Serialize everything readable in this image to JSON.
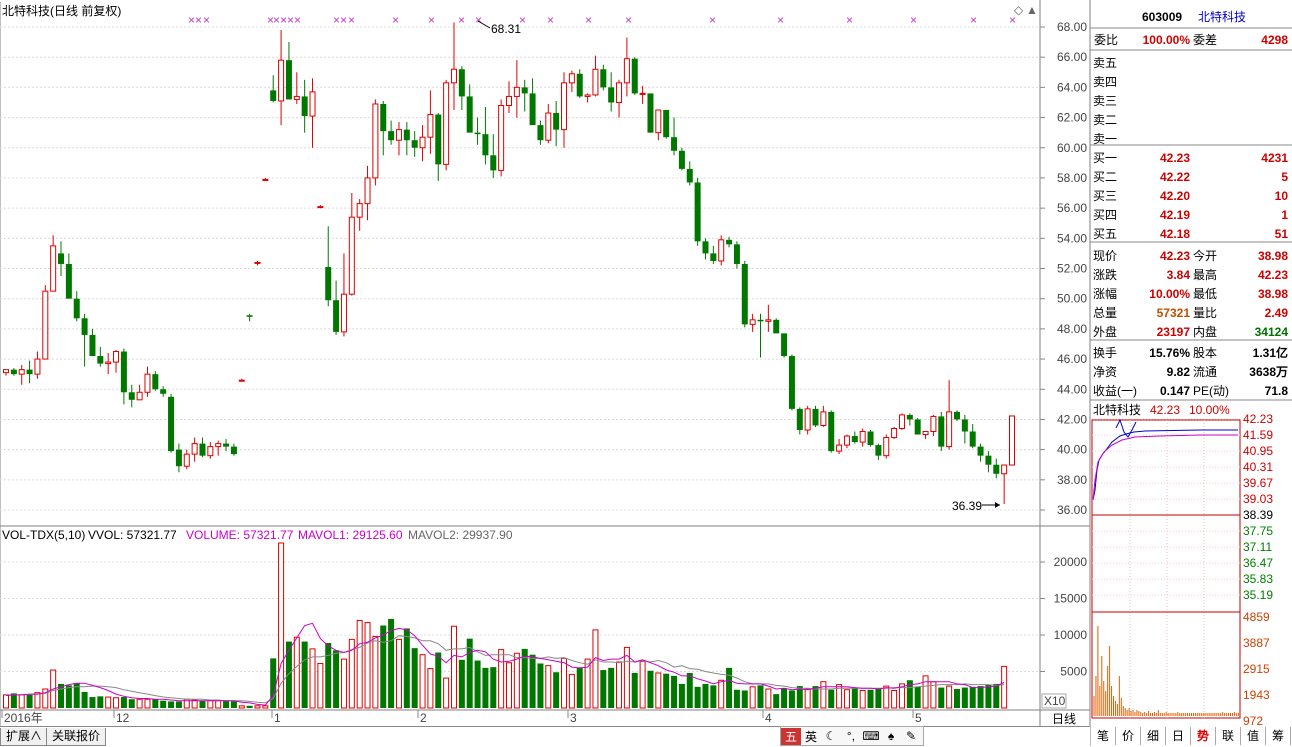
{
  "header": {
    "title": "北特科技(日线 前复权)",
    "indicator_line": {
      "name": "VOL-TDX(5,10)",
      "vvol": "VVOL: 57321.77",
      "volume": "VOLUME: 57321.77",
      "mavol1": "MAVOL1: 29125.60",
      "mavol2": "MAVOL2: 29937.90"
    }
  },
  "price_axis": [
    "68.00",
    "66.00",
    "64.00",
    "62.00",
    "60.00",
    "58.00",
    "56.00",
    "54.00",
    "52.00",
    "50.00",
    "48.00",
    "46.00",
    "44.00",
    "42.00",
    "40.00",
    "38.00",
    "36.00"
  ],
  "vol_axis": [
    "20000",
    "15000",
    "10000",
    "5000"
  ],
  "vol_multiplier": "X10",
  "annotations": {
    "high": "68.31",
    "low": "36.39"
  },
  "x_labels": [
    "2016年",
    "12",
    "1",
    "2",
    "3",
    "4",
    "5"
  ],
  "period_label": "日线",
  "bottom_tabs": [
    "扩展∧",
    "关联报价"
  ],
  "ime_label": "英",
  "ime_icons": [
    "五",
    "英",
    "moon-icon",
    "dots-icon",
    "keyboard-icon",
    "shirt-icon",
    "wrench-icon"
  ],
  "quote": {
    "code": "603009",
    "name": "北特科技",
    "wei_bi_label": "委比",
    "wei_bi": "100.00%",
    "wei_cha_label": "委差",
    "wei_cha": "4298",
    "sells": [
      {
        "label": "卖五",
        "price": "",
        "vol": ""
      },
      {
        "label": "卖四",
        "price": "",
        "vol": ""
      },
      {
        "label": "卖三",
        "price": "",
        "vol": ""
      },
      {
        "label": "卖二",
        "price": "",
        "vol": ""
      },
      {
        "label": "卖一",
        "price": "",
        "vol": ""
      }
    ],
    "buys": [
      {
        "label": "买一",
        "price": "42.23",
        "vol": "4231"
      },
      {
        "label": "买二",
        "price": "42.22",
        "vol": "5"
      },
      {
        "label": "买三",
        "price": "42.20",
        "vol": "10"
      },
      {
        "label": "买四",
        "price": "42.19",
        "vol": "1"
      },
      {
        "label": "买五",
        "price": "42.18",
        "vol": "51"
      }
    ],
    "stats": [
      {
        "l1": "现价",
        "v1": "42.23",
        "c1": "#d00000",
        "l2": "今开",
        "v2": "38.98",
        "c2": "#d00000"
      },
      {
        "l1": "涨跌",
        "v1": "3.84",
        "c1": "#d00000",
        "l2": "最高",
        "v2": "42.23",
        "c2": "#d00000"
      },
      {
        "l1": "涨幅",
        "v1": "10.00%",
        "c1": "#d00000",
        "l2": "最低",
        "v2": "38.98",
        "c2": "#d00000"
      },
      {
        "l1": "总量",
        "v1": "57321",
        "c1": "#c05000",
        "l2": "量比",
        "v2": "2.49",
        "c2": "#d00000"
      },
      {
        "l1": "外盘",
        "v1": "23197",
        "c1": "#d00000",
        "l2": "内盘",
        "v2": "34124",
        "c2": "#007000"
      }
    ],
    "fund": [
      {
        "l1": "换手",
        "v1": "15.76%",
        "l2": "股本",
        "v2": "1.31亿"
      },
      {
        "l1": "净资",
        "v1": "9.82",
        "l2": "流通",
        "v2": "3638万"
      },
      {
        "l1": "收益(一)",
        "v1": "0.147",
        "l2": "PE(动)",
        "v2": "71.8"
      }
    ]
  },
  "mini": {
    "name": "北特科技",
    "price": "42.23",
    "pct": "10.00%",
    "price_ticks": [
      "42.23",
      "41.59",
      "40.95",
      "40.31",
      "39.67",
      "39.03",
      "38.39",
      "37.75",
      "37.11",
      "36.47",
      "35.83",
      "35.19"
    ],
    "vol_ticks": [
      "4859",
      "3887",
      "2915",
      "1943",
      "972"
    ]
  },
  "side_tabs": [
    "笔",
    "价",
    "细",
    "日",
    "势",
    "联",
    "值",
    "筹"
  ],
  "active_side_tab": "势",
  "colors": {
    "up": "#e00000",
    "down": "#007800",
    "ma1": "#cc00cc",
    "ma2": "#888888",
    "marker": "#cc33cc"
  },
  "chart_data": {
    "type": "candlestick",
    "price_range": [
      35.5,
      69
    ],
    "volume_range": [
      0,
      23800
    ],
    "candles": [
      [
        45.1,
        45.3,
        44.9,
        45.3
      ],
      [
        45.3,
        45.4,
        44.9,
        45.0
      ],
      [
        45.0,
        45.6,
        44.3,
        45.3
      ],
      [
        45.3,
        45.9,
        44.4,
        45.0
      ],
      [
        45.0,
        46.5,
        44.7,
        46.0
      ],
      [
        46.0,
        50.9,
        46.0,
        50.5
      ],
      [
        50.5,
        54.2,
        50.5,
        53.5
      ],
      [
        53.0,
        53.8,
        51.5,
        52.3
      ],
      [
        52.3,
        53.0,
        51.0,
        50.0
      ],
      [
        50.0,
        50.5,
        48.5,
        48.7
      ],
      [
        48.7,
        49.0,
        45.5,
        47.6
      ],
      [
        47.6,
        48.0,
        46.2,
        46.2
      ],
      [
        46.2,
        46.8,
        45.5,
        45.7
      ],
      [
        45.7,
        46.4,
        45.0,
        45.8
      ],
      [
        45.8,
        46.6,
        45.1,
        46.5
      ],
      [
        46.5,
        46.7,
        43.0,
        43.8
      ],
      [
        43.8,
        44.3,
        42.8,
        43.3
      ],
      [
        43.3,
        44.3,
        43.5,
        43.8
      ],
      [
        43.8,
        45.5,
        43.5,
        45.0
      ],
      [
        45.0,
        45.2,
        43.9,
        44.0
      ],
      [
        44.0,
        44.2,
        43.5,
        43.7
      ],
      [
        43.5,
        43.7,
        39.8,
        39.9
      ],
      [
        40.0,
        40.4,
        38.5,
        38.9
      ],
      [
        38.9,
        40.0,
        38.7,
        39.7
      ],
      [
        39.7,
        40.8,
        39.2,
        40.4
      ],
      [
        40.4,
        40.8,
        39.5,
        39.6
      ],
      [
        39.6,
        40.5,
        39.4,
        40.2
      ],
      [
        40.2,
        40.6,
        39.6,
        40.4
      ],
      [
        40.4,
        40.7,
        39.9,
        40.2
      ],
      [
        40.2,
        40.4,
        39.6,
        39.7
      ],
      [
        44.6,
        44.7,
        44.5,
        44.6
      ],
      [
        48.9,
        49.0,
        48.5,
        48.8
      ],
      [
        52.4,
        52.5,
        52.2,
        52.4
      ],
      [
        57.9,
        58.0,
        57.8,
        57.9
      ],
      [
        63.8,
        64.8,
        63.0,
        63.1
      ],
      [
        63.1,
        67.8,
        61.5,
        65.8
      ],
      [
        65.8,
        67.0,
        63.3,
        63.2
      ],
      [
        63.2,
        65.0,
        62.9,
        63.4
      ],
      [
        63.4,
        64.5,
        61.0,
        62.1
      ],
      [
        62.1,
        64.6,
        60.0,
        63.7
      ],
      [
        56.1,
        56.2,
        56.0,
        56.1
      ],
      [
        52.1,
        54.8,
        49.5,
        49.9
      ],
      [
        49.9,
        51.2,
        47.6,
        47.8
      ],
      [
        47.8,
        53.0,
        47.5,
        50.3
      ],
      [
        50.3,
        57.0,
        50.2,
        55.4
      ],
      [
        55.4,
        56.6,
        54.5,
        56.3
      ],
      [
        56.3,
        58.8,
        55.2,
        58.0
      ],
      [
        58.0,
        63.2,
        57.5,
        62.9
      ],
      [
        62.9,
        63.1,
        59.5,
        61.1
      ],
      [
        61.1,
        61.8,
        60.2,
        60.5
      ],
      [
        60.5,
        61.7,
        59.5,
        61.2
      ],
      [
        61.2,
        61.7,
        59.5,
        60.5
      ],
      [
        60.5,
        61.1,
        59.4,
        60.0
      ],
      [
        60.0,
        61.5,
        59.1,
        60.7
      ],
      [
        60.7,
        63.8,
        59.6,
        62.2
      ],
      [
        62.2,
        62.3,
        57.8,
        58.9
      ],
      [
        58.9,
        64.5,
        58.5,
        64.3
      ],
      [
        64.3,
        68.3,
        62.5,
        65.2
      ],
      [
        65.2,
        65.4,
        62.5,
        63.4
      ],
      [
        63.4,
        64.2,
        61.2,
        61.0
      ],
      [
        61.0,
        62.0,
        60.2,
        60.9
      ],
      [
        60.9,
        62.7,
        58.9,
        59.5
      ],
      [
        59.5,
        60.9,
        58.0,
        58.5
      ],
      [
        58.5,
        63.2,
        58.1,
        62.8
      ],
      [
        62.8,
        64.4,
        62.3,
        63.4
      ],
      [
        63.4,
        65.8,
        62.0,
        64.0
      ],
      [
        64.0,
        64.5,
        62.4,
        63.6
      ],
      [
        63.6,
        64.6,
        62.5,
        61.5
      ],
      [
        61.5,
        61.8,
        60.2,
        60.5
      ],
      [
        60.5,
        62.9,
        60.3,
        62.3
      ],
      [
        62.3,
        63.1,
        60.1,
        61.2
      ],
      [
        61.2,
        65.0,
        60.0,
        64.3
      ],
      [
        64.3,
        65.1,
        63.7,
        64.9
      ],
      [
        64.9,
        65.2,
        63.3,
        63.4
      ],
      [
        63.4,
        63.6,
        63.0,
        63.5
      ],
      [
        63.5,
        66.1,
        63.4,
        65.2
      ],
      [
        65.2,
        65.5,
        63.8,
        64.0
      ],
      [
        64.0,
        65.0,
        62.4,
        63.0
      ],
      [
        63.0,
        64.5,
        62.0,
        64.3
      ],
      [
        64.3,
        67.3,
        63.4,
        65.9
      ],
      [
        65.9,
        66.0,
        63.5,
        63.6
      ],
      [
        63.6,
        64.1,
        62.9,
        63.6
      ],
      [
        63.6,
        63.0,
        61.7,
        61.0
      ],
      [
        61.0,
        62.1,
        60.5,
        62.5
      ],
      [
        62.5,
        62.5,
        60.6,
        60.7
      ],
      [
        60.7,
        62.0,
        59.5,
        59.8
      ],
      [
        59.8,
        60.0,
        58.5,
        58.6
      ],
      [
        58.6,
        59.1,
        57.5,
        57.7
      ],
      [
        57.7,
        58.0,
        53.5,
        53.8
      ],
      [
        53.8,
        54.0,
        52.6,
        53.0
      ],
      [
        53.0,
        53.5,
        52.3,
        52.5
      ],
      [
        52.5,
        54.2,
        52.2,
        53.9
      ],
      [
        53.9,
        54.1,
        53.4,
        53.6
      ],
      [
        53.6,
        53.8,
        52.0,
        52.3
      ],
      [
        52.3,
        52.5,
        48.1,
        48.3
      ],
      [
        48.3,
        49.0,
        47.8,
        48.6
      ],
      [
        48.6,
        49.0,
        46.1,
        48.5
      ],
      [
        48.5,
        49.6,
        47.8,
        48.6
      ],
      [
        48.6,
        48.7,
        47.8,
        47.7
      ],
      [
        47.7,
        47.7,
        46.1,
        46.2
      ],
      [
        46.2,
        46.3,
        42.6,
        42.7
      ],
      [
        42.7,
        42.8,
        41.0,
        41.3
      ],
      [
        41.3,
        42.9,
        41.0,
        42.7
      ],
      [
        42.7,
        42.9,
        41.5,
        41.6
      ],
      [
        41.6,
        42.9,
        41.5,
        42.5
      ],
      [
        42.5,
        42.6,
        39.8,
        39.9
      ],
      [
        39.9,
        40.7,
        39.7,
        40.3
      ],
      [
        40.3,
        41.0,
        40.1,
        40.9
      ],
      [
        40.9,
        41.2,
        40.4,
        40.5
      ],
      [
        40.5,
        41.4,
        40.2,
        41.2
      ],
      [
        41.2,
        41.3,
        40.2,
        40.3
      ],
      [
        40.3,
        40.4,
        39.3,
        39.6
      ],
      [
        39.6,
        41.0,
        39.4,
        40.8
      ],
      [
        40.8,
        41.5,
        40.7,
        41.4
      ],
      [
        41.4,
        42.4,
        41.3,
        42.3
      ],
      [
        42.3,
        42.4,
        41.6,
        42.0
      ],
      [
        42.0,
        42.1,
        41.1,
        41.0
      ],
      [
        41.0,
        41.2,
        40.7,
        41.2
      ],
      [
        41.2,
        42.3,
        40.9,
        42.2
      ],
      [
        42.2,
        42.5,
        39.9,
        40.2
      ],
      [
        40.2,
        44.6,
        40.0,
        42.5
      ],
      [
        42.5,
        42.6,
        41.9,
        42.0
      ],
      [
        42.0,
        42.3,
        40.4,
        41.2
      ],
      [
        41.2,
        41.7,
        40.1,
        40.2
      ],
      [
        40.2,
        40.4,
        39.2,
        39.6
      ],
      [
        39.6,
        39.9,
        38.5,
        39.0
      ],
      [
        39.0,
        39.4,
        38.1,
        38.4
      ],
      [
        38.4,
        38.6,
        36.4,
        38.98
      ],
      [
        38.98,
        42.23,
        38.98,
        42.23
      ]
    ],
    "volumes": [
      1800,
      2000,
      1800,
      1800,
      2100,
      2600,
      5200,
      3300,
      3100,
      3400,
      2200,
      1500,
      1600,
      1500,
      1400,
      1500,
      1200,
      1200,
      1200,
      1200,
      1000,
      900,
      900,
      1200,
      1100,
      1000,
      1000,
      1000,
      1000,
      900,
      300,
      300,
      300,
      300,
      6800,
      22600,
      9100,
      9700,
      9100,
      8100,
      6100,
      8900,
      7900,
      6700,
      9400,
      12000,
      11700,
      9800,
      11300,
      12200,
      9400,
      10900,
      8200,
      7300,
      5400,
      7600,
      4100,
      11200,
      6600,
      9500,
      6500,
      5500,
      5600,
      8000,
      6200,
      7500,
      8100,
      7300,
      6100,
      5800,
      4900,
      6800,
      4600,
      5500,
      6700,
      10700,
      5200,
      5500,
      6300,
      8300,
      4800,
      6400,
      5100,
      4800,
      4700,
      4400,
      3300,
      4800,
      2900,
      3300,
      3100,
      3800,
      5500,
      2500,
      2400,
      2900,
      3100,
      2600,
      1900,
      2700,
      2400,
      3000,
      2600,
      3000,
      3600,
      2500,
      3200,
      2500,
      2700,
      2400,
      2500,
      2700,
      3000,
      2400,
      3300,
      3800,
      2900,
      4400,
      3600,
      2800,
      3000,
      2600,
      2800,
      2900,
      3000,
      3200,
      3300,
      5700
    ],
    "mavol1": [
      1700,
      1800,
      1800,
      1900,
      1900,
      2100,
      2600,
      2900,
      3200,
      3400,
      3400,
      3100,
      2800,
      2400,
      1900,
      1600,
      1400,
      1300,
      1300,
      1200,
      1200,
      1100,
      1000,
      1000,
      1000,
      1000,
      1000,
      1000,
      1000,
      1000,
      800,
      700,
      500,
      400,
      1700,
      6100,
      7900,
      9600,
      11300,
      11600,
      9500,
      8500,
      7900,
      7600,
      7900,
      8800,
      9000,
      9600,
      10000,
      10600,
      10900,
      10700,
      9900,
      8600,
      7400,
      7100,
      6200,
      7200,
      7000,
      7600,
      7900,
      7700,
      6700,
      6300,
      6400,
      6700,
      7100,
      7000,
      6800,
      6600,
      6400,
      6200,
      5600,
      5500,
      5600,
      6900,
      6500,
      6700,
      6700,
      7200,
      6300,
      6600,
      6200,
      5800,
      5200,
      4900,
      4400,
      4400,
      4000,
      3700,
      3300,
      3600,
      3800,
      3400,
      3300,
      3300,
      3300,
      3000,
      2600,
      2700,
      2500,
      2600,
      2500,
      2700,
      2900,
      2900,
      2900,
      2900,
      2800,
      2700,
      2700,
      2600,
      2800,
      2700,
      2900,
      3200,
      3300,
      3600,
      3600,
      3600,
      3600,
      3300,
      3200,
      2800,
      2800,
      2900,
      3000,
      3500
    ],
    "mavol2": [
      1800,
      1800,
      1800,
      1850,
      1900,
      2000,
      2400,
      2600,
      2800,
      2900,
      2900,
      3000,
      3000,
      2900,
      2800,
      2500,
      2300,
      2100,
      1900,
      1700,
      1500,
      1400,
      1300,
      1200,
      1200,
      1200,
      1100,
      1100,
      1000,
      1000,
      1000,
      900,
      800,
      700,
      1300,
      3400,
      4700,
      5700,
      6600,
      7000,
      7000,
      7200,
      7500,
      7600,
      8000,
      8300,
      8900,
      9200,
      9000,
      9200,
      9900,
      9800,
      9600,
      9200,
      9200,
      8800,
      7900,
      8100,
      8100,
      8300,
      7700,
      7200,
      7300,
      7300,
      7300,
      6900,
      6900,
      6800,
      6800,
      7000,
      6800,
      6900,
      6500,
      6200,
      6000,
      6600,
      6300,
      6300,
      6200,
      6400,
      6300,
      6500,
      6300,
      6500,
      6200,
      5600,
      5800,
      5400,
      5300,
      5000,
      4800,
      4600,
      4500,
      4100,
      3600,
      3300,
      3300,
      3300,
      3100,
      3000,
      2800,
      2700,
      2700,
      2600,
      2600,
      2600,
      2700,
      2700,
      2700,
      2700,
      2700,
      2700,
      2700,
      2800,
      2800,
      2800,
      2900,
      3000,
      3100,
      3200,
      3200,
      3200,
      3300,
      3200,
      3200,
      3200,
      3100,
      3200
    ]
  }
}
